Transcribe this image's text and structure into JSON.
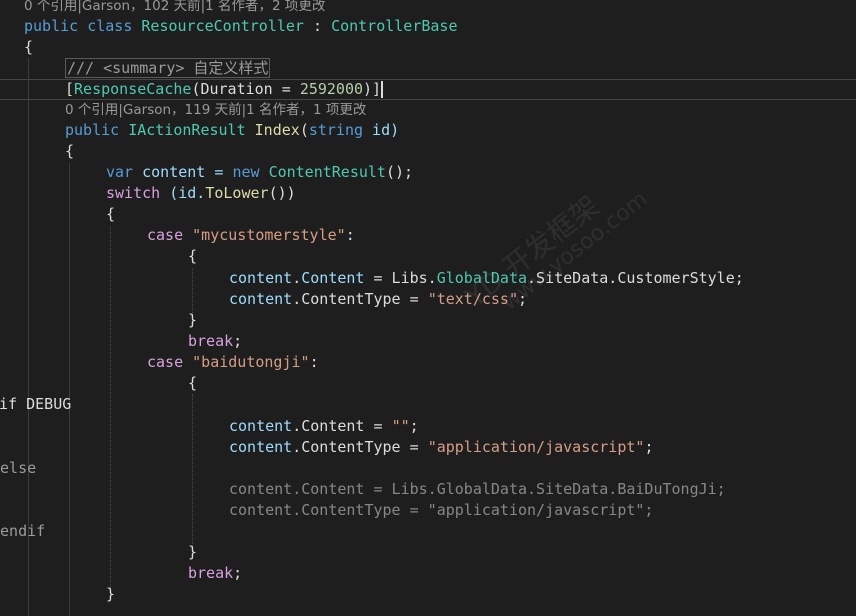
{
  "editor": {
    "lens_top": "0 个引用|Garson，102 天前|1 名作者，2 项更改",
    "lens_index": "0 个引用|Garson，119 天前|1 名作者，1 项更改",
    "class_decl": {
      "public": "public",
      "class": "class",
      "name": "ResourceController",
      "colon": " : ",
      "base": "ControllerBase"
    },
    "brace_open": "{",
    "brace_close": "}",
    "summary_comment": "/// <summary> 自定义样式",
    "attribute": {
      "open": "[",
      "name": "ResponseCache",
      "args": "(Duration = ",
      "value": "2592000",
      "close": ")]"
    },
    "method_decl": {
      "public": "public",
      "return_type": "IActionResult",
      "name": "Index",
      "params_open": "(",
      "param_type": "string",
      "param_name": " id)"
    },
    "var_line": {
      "var": "var",
      "name": " content = ",
      "new": "new",
      "type": "ContentResult",
      "rest": "();"
    },
    "switch_line": {
      "switch": "switch",
      "expr": " (id.",
      "method": "ToLower",
      "rest": "())"
    },
    "case1": {
      "case": "case",
      "value": "\"mycustomerstyle\"",
      "colon": ":"
    },
    "case1_content": {
      "obj": "content",
      "dot": ".",
      "prop": "Content",
      "eq": " = Libs.",
      "cls": "GlobalData",
      "tail": ".SiteData.CustomerStyle;"
    },
    "case1_type": {
      "obj": "content",
      "prop": ".ContentType = ",
      "value": "\"text/css\"",
      "semi": ";"
    },
    "break": "break",
    "semi": ";",
    "case2": {
      "case": "case",
      "value": "\"baidutongji\"",
      "colon": ":"
    },
    "pp_if": "#if DEBUG",
    "pp_else": "#else",
    "pp_endif": "#endif",
    "case2_content_debug": {
      "obj": "content",
      "prop": ".Content = ",
      "value": "\"\"",
      "semi": ";"
    },
    "case2_type_debug": {
      "obj": "content",
      "prop": ".ContentType = ",
      "value": "\"application/javascript\"",
      "semi": ";"
    },
    "case2_content_release": "content.Content = Libs.GlobalData.SiteData.BaiDuTongJi;",
    "case2_type_release": "content.ContentType = \"application/javascript\";",
    "watermark_line1": "YD 开发框架",
    "watermark_line2": "www.yosoo.com"
  }
}
